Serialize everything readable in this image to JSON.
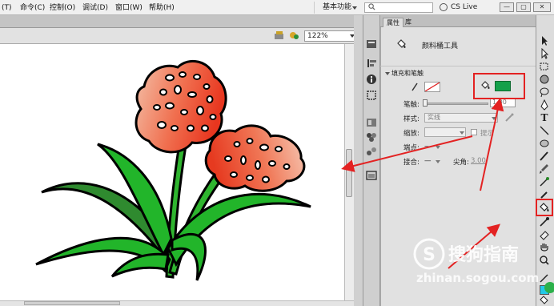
{
  "menubar": {
    "items": [
      "(T)",
      "命令(C)",
      "控制(O)",
      "调试(D)",
      "窗口(W)",
      "帮助(H)"
    ],
    "workspace_label": "基本功能",
    "cslive_label": "CS Live",
    "window_buttons": [
      "—",
      "▢",
      "✕"
    ]
  },
  "doc_toolbar": {
    "zoom_value": "122%"
  },
  "panel": {
    "tabs": [
      "属性",
      "库"
    ],
    "tool_title": "颜料桶工具",
    "section_title": "填充和笔触",
    "stroke_label": "笔触:",
    "stroke_value": "1.00",
    "style_label": "样式:",
    "style_value": "实线",
    "scale_label": "缩放:",
    "hint_label": "提示",
    "cap_label": "端点:",
    "join_label": "接合:",
    "miter_label": "尖角:",
    "miter_value": "3.00",
    "fill_color": "#14a04a"
  },
  "watermark": {
    "brand": "搜狗指南",
    "url": "zhinan.sogou.com"
  },
  "colors": {
    "highlight": "#e32222",
    "annotation_arrow": "#e32222",
    "petal_base": "#f05a3a",
    "leaf": "#2fb52f"
  }
}
